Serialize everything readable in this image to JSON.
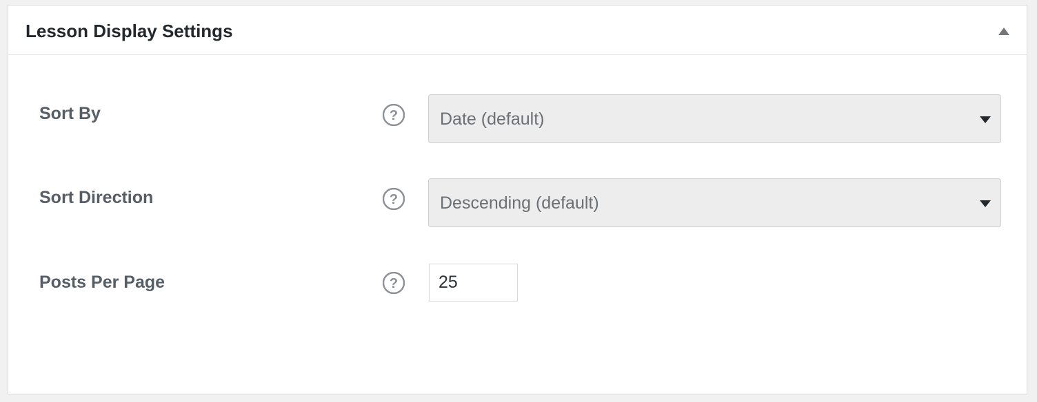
{
  "panel": {
    "title": "Lesson Display Settings",
    "toggle_icon": "caret-up-icon"
  },
  "fields": {
    "sort_by": {
      "label": "Sort By",
      "help_icon": "question-circle-icon",
      "selected": "Date (default)"
    },
    "sort_direction": {
      "label": "Sort Direction",
      "help_icon": "question-circle-icon",
      "selected": "Descending (default)"
    },
    "posts_per_page": {
      "label": "Posts Per Page",
      "help_icon": "question-circle-icon",
      "value": "25"
    }
  },
  "colors": {
    "title": "#23282d",
    "label": "#555d66",
    "select_bg": "#ededed",
    "select_text": "#6b7075",
    "icon": "#8c8f94"
  }
}
